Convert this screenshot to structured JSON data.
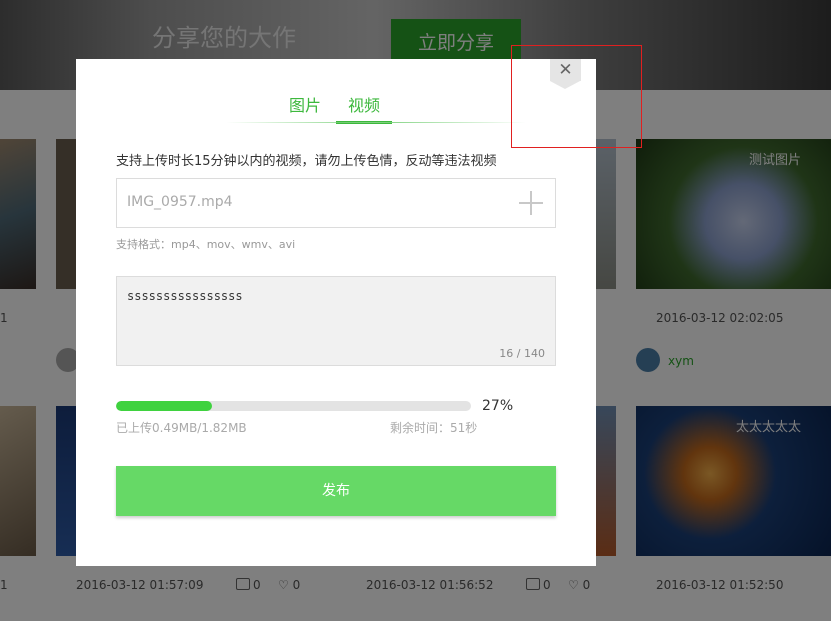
{
  "background": {
    "banner_title": "分享您的大作",
    "banner_subtitle": "",
    "banner_button": "立即分享",
    "thumb_captions": [
      "测试图片",
      "太太太太太"
    ],
    "row1": [
      {
        "likes": "1"
      },
      {
        "date": "2016-03-12 02:02:05",
        "author": "xym"
      }
    ],
    "row2": [
      {
        "likes": "1"
      },
      {
        "date": "2016-03-12 01:57:09",
        "comments": "0",
        "likes": "0"
      },
      {
        "date": "2016-03-12 01:56:52",
        "comments": "0",
        "likes": "0"
      },
      {
        "date": "2016-03-12 01:52:50"
      }
    ]
  },
  "modal": {
    "close_glyph": "✕",
    "tabs": [
      {
        "label": "图片",
        "active": false
      },
      {
        "label": "视频",
        "active": true
      }
    ],
    "notice": "支持上传时长15分钟以内的视频，请勿上传色情，反动等违法视频",
    "file": {
      "name": "IMG_0957.mp4",
      "add_icon": "plus-icon"
    },
    "formats": "支持格式：mp4、mov、wmv、avi",
    "description": {
      "value": "ssssssssssssssss",
      "counter": "16 / 140"
    },
    "progress": {
      "percent": 27,
      "percent_label": "27%",
      "uploaded": "已上传0.49MB/1.82MB",
      "remaining": "剩余时间：51秒"
    },
    "publish_label": "发布"
  },
  "colors": {
    "accent": "#3db83d",
    "publish": "#66d966",
    "progress": "#3fd23f",
    "debug_box": "#e02020"
  }
}
